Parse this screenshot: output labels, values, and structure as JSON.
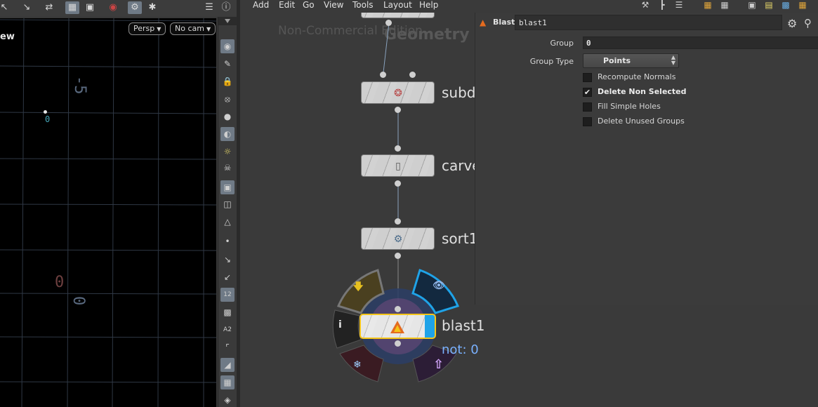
{
  "menu": {
    "items": [
      "Add",
      "Edit",
      "Go",
      "View",
      "Tools",
      "Layout",
      "Help"
    ]
  },
  "viewport": {
    "title": "ew",
    "camera_pill": "Persp",
    "cam_pill": "No cam",
    "axis_labels": {
      "neg5": "-5",
      "zero_small": "0",
      "zero_a": "0",
      "zero_b": "0"
    },
    "side_tools": [
      "view-tool-icon",
      "paint-icon",
      "lock-icon",
      "snap-icon",
      "shading-icon",
      "light-icon",
      "bulb-icon",
      "skull-icon",
      "camera-icon",
      "render-icon",
      "pose-icon",
      "point-icon",
      "brush-icon",
      "pen-icon",
      "number-icon",
      "eraser-icon",
      "label-icon",
      "corner-icon",
      "shaded-icon",
      "checker-icon",
      "layers-icon"
    ]
  },
  "network": {
    "watermark": "Non-Commercial Edition",
    "context": "Geometry",
    "nodes": [
      {
        "label": "subd",
        "icon": "subdivide-icon"
      },
      {
        "label": "carve",
        "icon": "carve-icon"
      },
      {
        "label": "sort1",
        "icon": "sort-icon"
      },
      {
        "label": "blast1",
        "icon": "blast-icon"
      }
    ],
    "blast_note": "not: 0"
  },
  "params": {
    "node_type": "Blast",
    "node_name": "blast1",
    "group_label": "Group",
    "group_value": "0",
    "group_type_label": "Group Type",
    "group_type_value": "Points",
    "checkboxes": [
      {
        "label": "Recompute Normals",
        "checked": false
      },
      {
        "label": "Delete Non Selected",
        "checked": true
      },
      {
        "label": "Fill Simple Holes",
        "checked": false
      },
      {
        "label": "Delete Unused Groups",
        "checked": false
      }
    ]
  },
  "colors": {
    "selection": "#f5c518",
    "display_flag": "#1fa3e8",
    "note": "#7ab1ff",
    "blast_icon": "#e46b1f"
  }
}
